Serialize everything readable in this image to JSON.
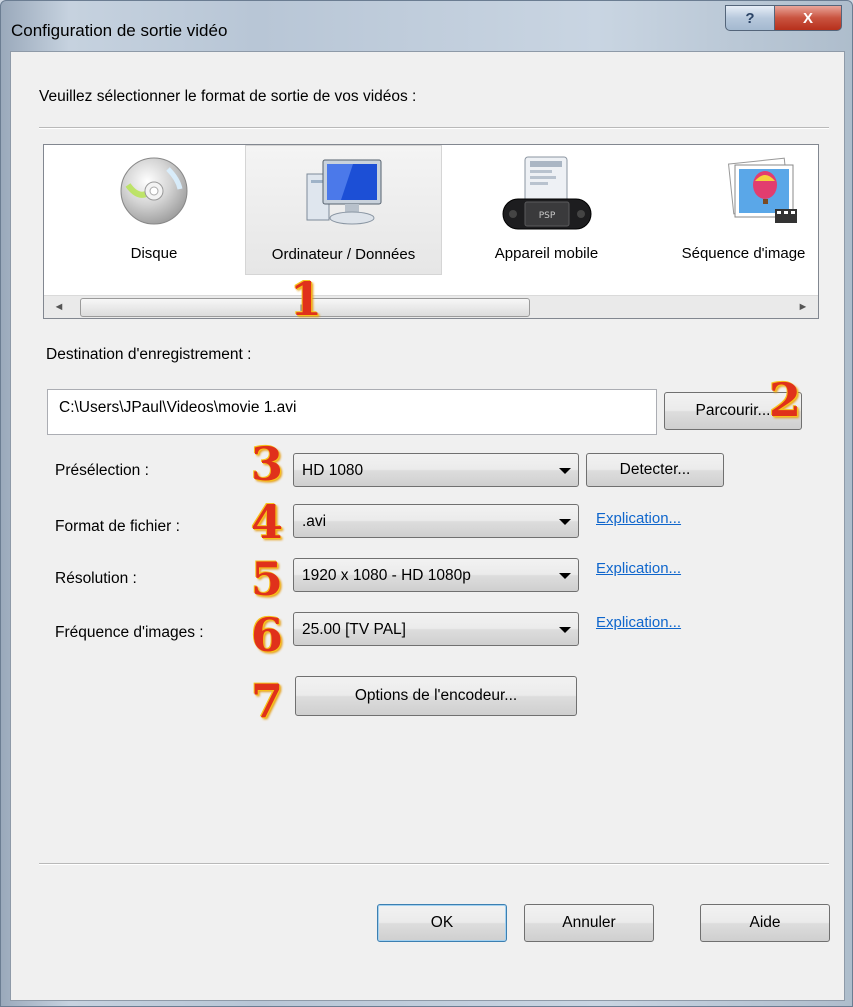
{
  "window": {
    "title": "Configuration de sortie vidéo",
    "help_btn": "?",
    "close_btn": "X"
  },
  "instruction": "Veuillez sélectionner le format de sortie de vos vidéos :",
  "formats": [
    {
      "label": "Disque",
      "icon": "disc-icon",
      "selected": false
    },
    {
      "label": "Ordinateur / Données",
      "icon": "computer-icon",
      "selected": true
    },
    {
      "label": "Appareil mobile",
      "icon": "psp-device-icon",
      "selected": false
    },
    {
      "label": "Séquence d'image",
      "icon": "image-sequence-icon",
      "selected": false
    }
  ],
  "psp_text": "PSP",
  "scroll": {
    "left": "◄",
    "right": "►",
    "thumb_grip": "III"
  },
  "destination": {
    "label": "Destination d'enregistrement :",
    "path": "C:\\Users\\JPaul\\Videos\\movie 1.avi",
    "browse": "Parcourir..."
  },
  "preset": {
    "label": "Présélection :",
    "value": "HD 1080",
    "detect": "Detecter..."
  },
  "file_format": {
    "label": "Format de fichier :",
    "value": ".avi",
    "link": "Explication..."
  },
  "resolution": {
    "label": "Résolution :",
    "value": "1920 x 1080 - HD 1080p",
    "link": "Explication..."
  },
  "framerate": {
    "label": "Fréquence d'images :",
    "value": "25.00 [TV PAL]",
    "link": "Explication..."
  },
  "encoder_options": "Options de l'encodeur...",
  "buttons": {
    "ok": "OK",
    "cancel": "Annuler",
    "help": "Aide"
  },
  "markers": [
    "1",
    "2",
    "3",
    "4",
    "5",
    "6",
    "7"
  ],
  "colors": {
    "marker": "#e0311b",
    "link": "#0f66cc",
    "close": "#c9533f"
  }
}
